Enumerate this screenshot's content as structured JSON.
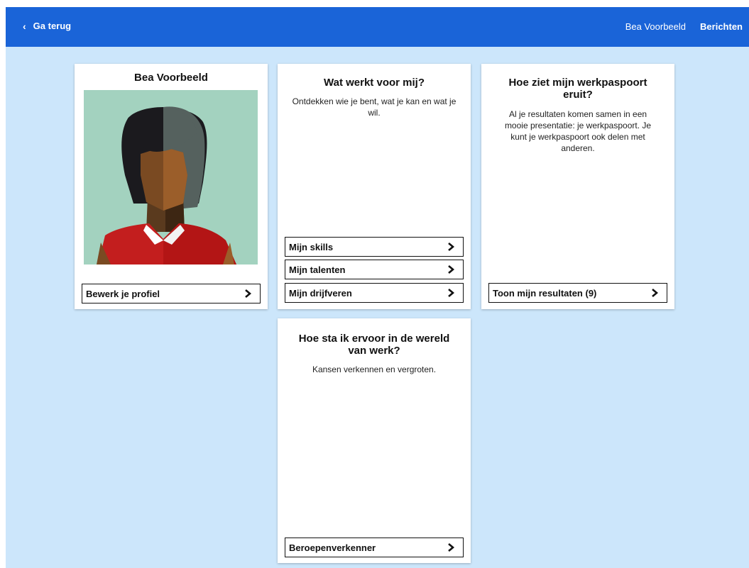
{
  "header": {
    "back_label": "Ga terug",
    "user_name": "Bea Voorbeeld",
    "messages_label": "Berichten",
    "color": "#1a64d8"
  },
  "background_color": "#cce6fb",
  "cards": {
    "profile": {
      "title": "Bea Voorbeeld",
      "button_label": "Bewerk je profiel"
    },
    "wat_werkt": {
      "title": "Wat werkt voor mij?",
      "description": "Ontdekken wie je bent, wat je kan en wat je wil.",
      "links": [
        {
          "label": "Mijn skills"
        },
        {
          "label": "Mijn talenten"
        },
        {
          "label": "Mijn drijfveren"
        }
      ]
    },
    "werkpaspoort": {
      "title": "Hoe ziet mijn werkpaspoort eruit?",
      "description": "Al je resultaten komen samen in een mooie presentatie: je werkpaspoort. Je kunt je werkpaspoort ook delen met anderen.",
      "button_label": "Toon mijn resultaten (9)"
    },
    "wereld_van_werk": {
      "title": "Hoe sta ik ervoor in de wereld van werk?",
      "description": "Kansen verkennen en vergroten.",
      "button_label": "Beroepenverkenner"
    }
  },
  "icons": {
    "back": "chevron-left-icon",
    "link_arrow": "chevron-right-icon"
  }
}
